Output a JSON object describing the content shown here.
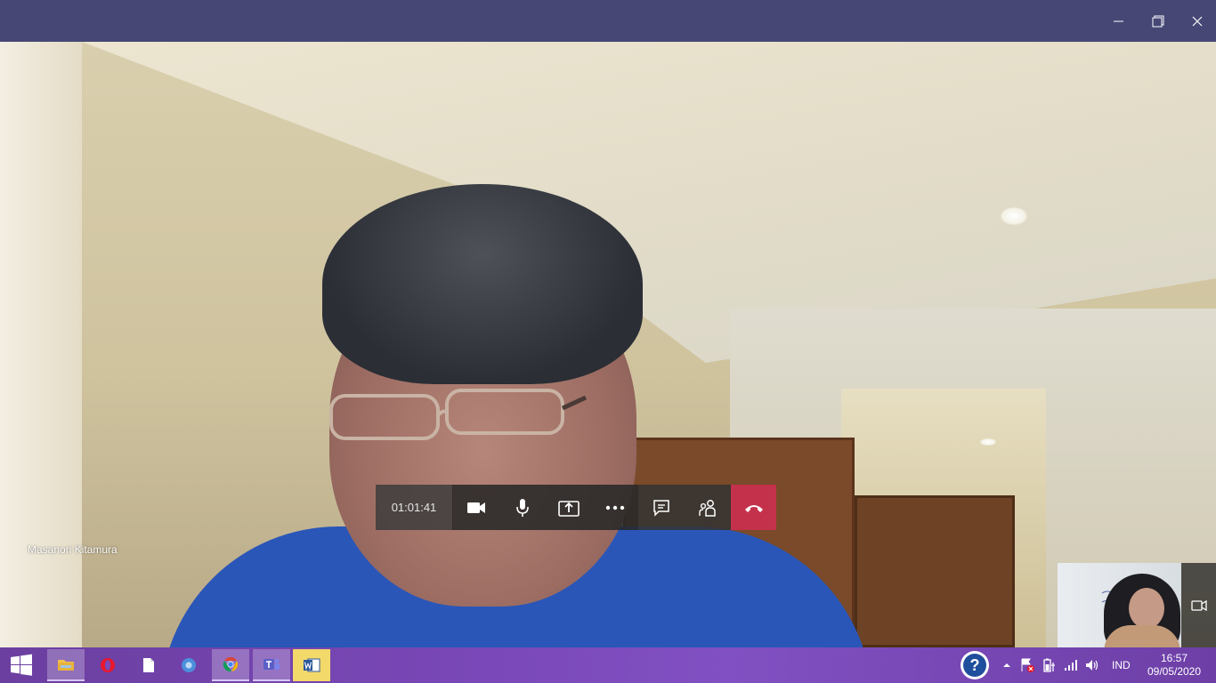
{
  "window": {
    "controls": {
      "minimize": "minimize-icon",
      "maximize": "restore-icon",
      "close": "close-icon"
    },
    "titlebar_color": "#464775"
  },
  "call": {
    "participant_name": "Masanori Kitamura",
    "duration": "01:01:41",
    "controls": [
      "camera-icon",
      "microphone-icon",
      "share-screen-icon",
      "more-options-icon",
      "chat-icon",
      "participants-icon",
      "hang-up-icon"
    ],
    "hang_up_color": "#c4314b"
  },
  "taskbar": {
    "apps": [
      "file-explorer-icon",
      "opera-icon",
      "document-icon",
      "chromium-icon",
      "chrome-icon",
      "teams-icon",
      "word-icon"
    ],
    "tray": {
      "language": "IND",
      "time": "16:57",
      "date": "09/05/2020"
    }
  }
}
